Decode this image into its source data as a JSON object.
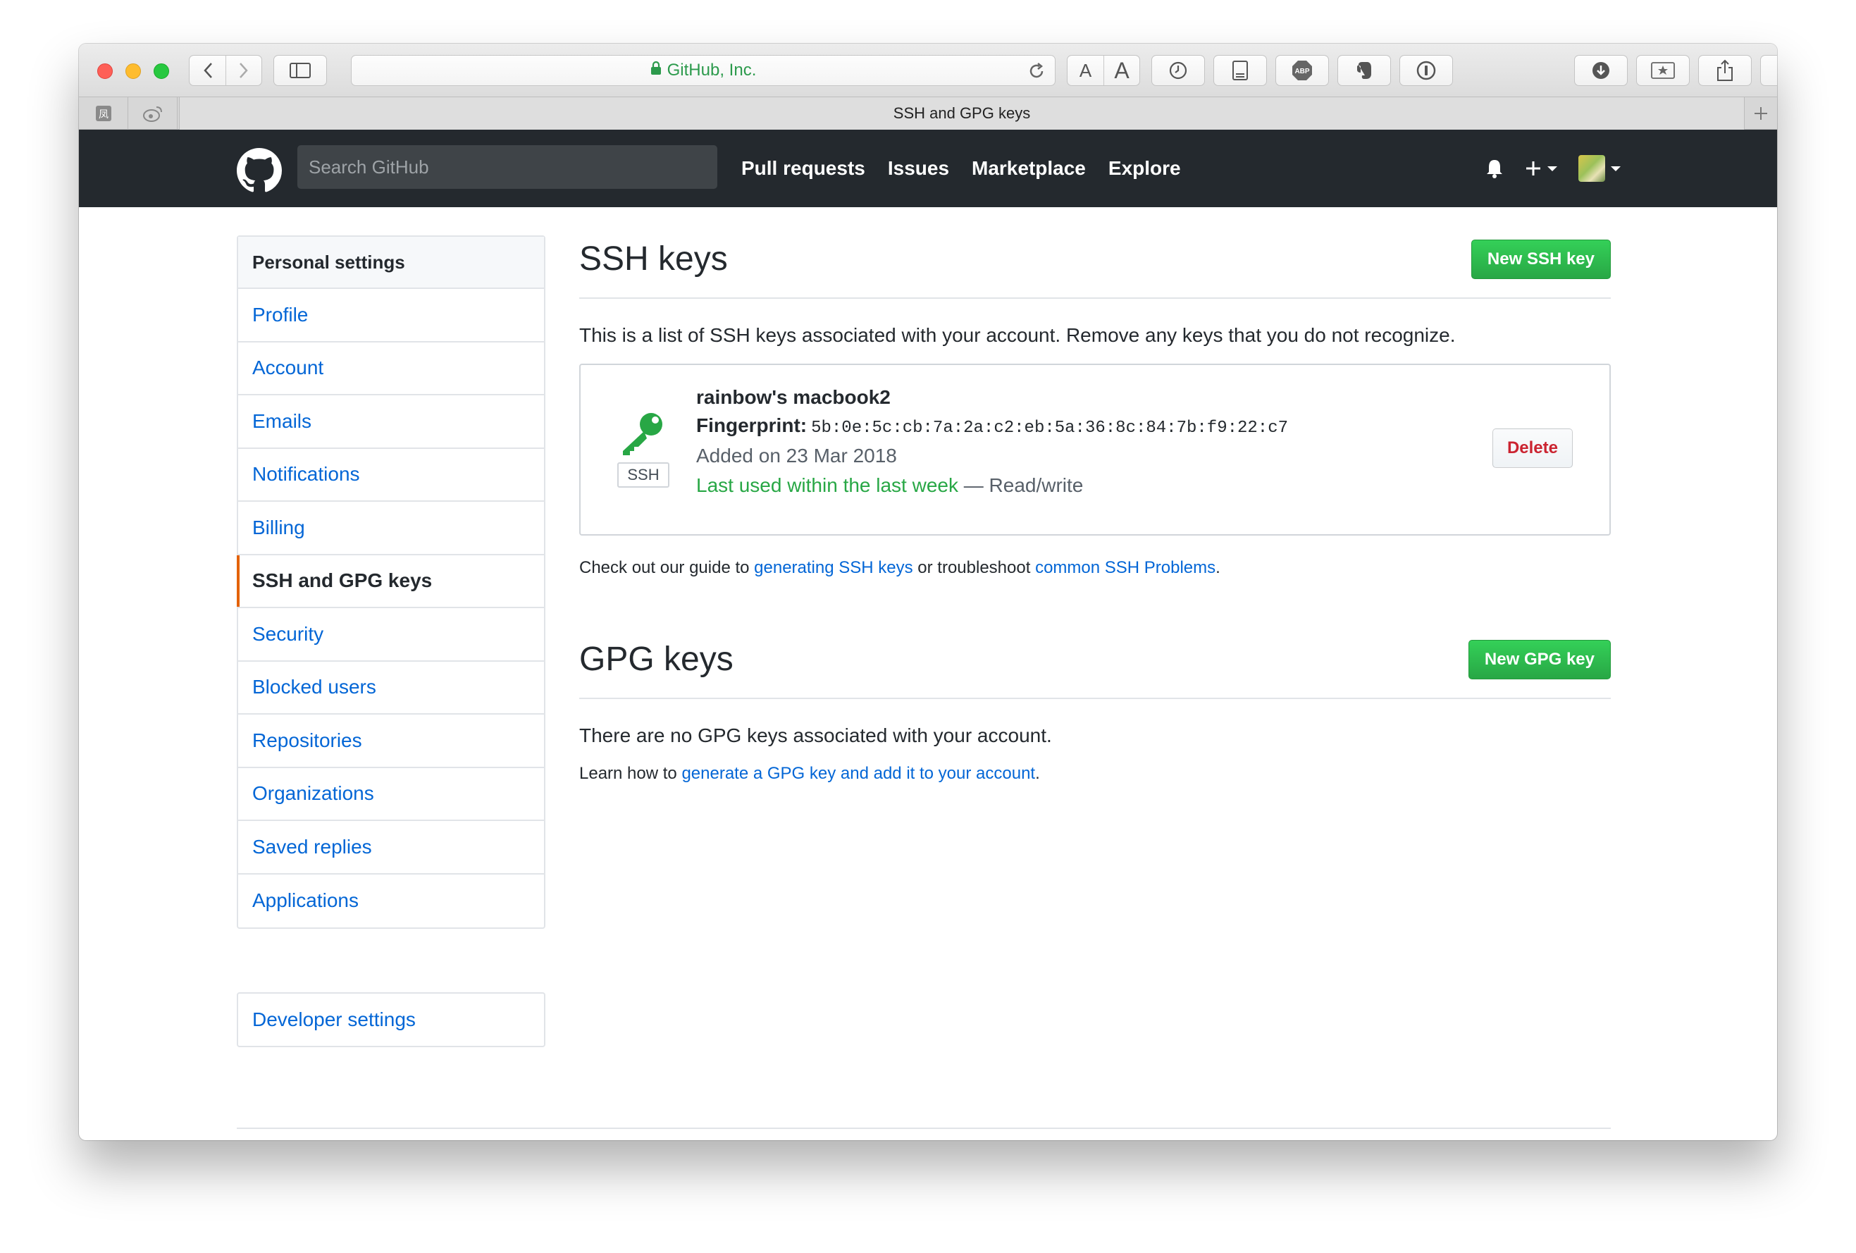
{
  "browser": {
    "url_label": "GitHub, Inc.",
    "tab_title": "SSH and GPG keys",
    "font_small": "A",
    "font_large": "A",
    "accent_url_color": "#2c9a4c"
  },
  "header": {
    "search_placeholder": "Search GitHub",
    "nav": [
      "Pull requests",
      "Issues",
      "Marketplace",
      "Explore"
    ]
  },
  "sidebar": {
    "heading": "Personal settings",
    "items": [
      {
        "label": "Profile"
      },
      {
        "label": "Account"
      },
      {
        "label": "Emails"
      },
      {
        "label": "Notifications"
      },
      {
        "label": "Billing"
      },
      {
        "label": "SSH and GPG keys",
        "selected": true
      },
      {
        "label": "Security"
      },
      {
        "label": "Blocked users"
      },
      {
        "label": "Repositories"
      },
      {
        "label": "Organizations"
      },
      {
        "label": "Saved replies"
      },
      {
        "label": "Applications"
      }
    ],
    "developer_settings": "Developer settings"
  },
  "ssh": {
    "title": "SSH keys",
    "new_button": "New SSH key",
    "description": "This is a list of SSH keys associated with your account. Remove any keys that you do not recognize.",
    "key": {
      "badge": "SSH",
      "name": "rainbow's macbook2",
      "fingerprint_label": "Fingerprint:",
      "fingerprint": "5b:0e:5c:cb:7a:2a:c2:eb:5a:36:8c:84:7b:f9:22:c7",
      "added": "Added on 23 Mar 2018",
      "last_used": "Last used within the last week",
      "access": "— Read/write",
      "delete_label": "Delete"
    },
    "guide": {
      "prefix": "Check out our guide to ",
      "link1": "generating SSH keys",
      "middle": " or troubleshoot ",
      "link2": "common SSH Problems",
      "suffix": "."
    }
  },
  "gpg": {
    "title": "GPG keys",
    "new_button": "New GPG key",
    "empty": "There are no GPG keys associated with your account.",
    "learn_prefix": "Learn how to ",
    "learn_link": "generate a GPG key and add it to your account",
    "learn_suffix": "."
  },
  "colors": {
    "header_bg": "#24292e",
    "link": "#0366d6",
    "green_button": "#28a745",
    "delete": "#cb2431",
    "selected_bar": "#e36209"
  }
}
